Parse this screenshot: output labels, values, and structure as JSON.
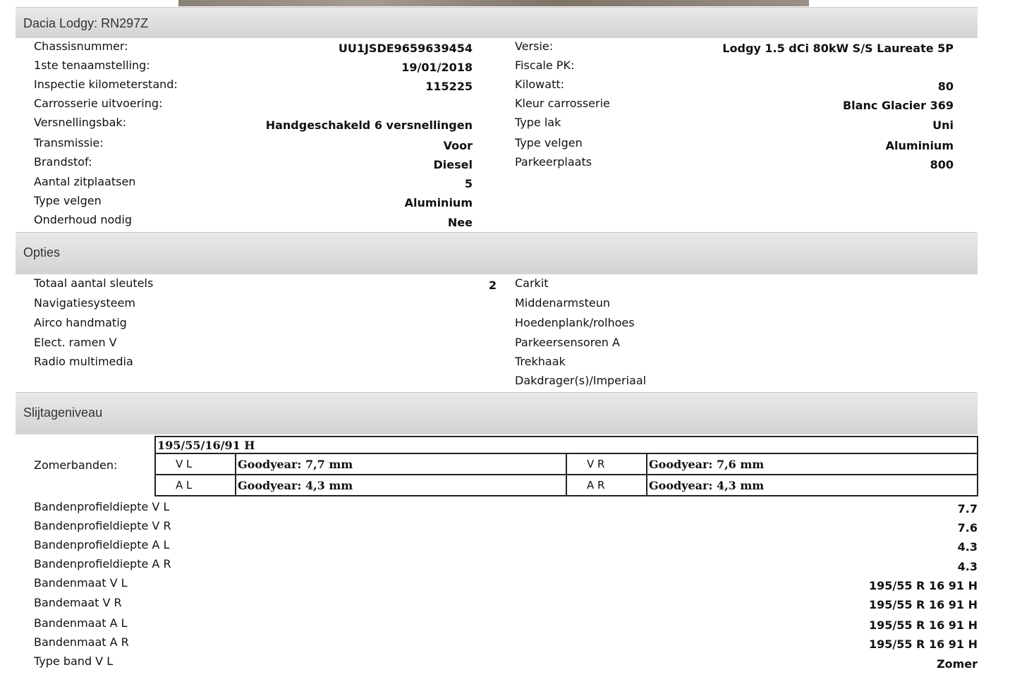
{
  "vehicle": {
    "title": "Dacia Lodgy: RN297Z",
    "left_specs": [
      {
        "label": "Chassisnummer:",
        "value": "UU1JSDE9659639454"
      },
      {
        "label": "1ste tenaamstelling:",
        "value": "19/01/2018"
      },
      {
        "label": "Inspectie kilometerstand:",
        "value": "115225"
      },
      {
        "label": "Carrosserie uitvoering:",
        "value": ""
      },
      {
        "label": "Versnellingsbak:",
        "value": "Handgeschakeld 6 versnellingen"
      },
      {
        "label": "Transmissie:",
        "value": "Voor"
      },
      {
        "label": "Brandstof:",
        "value": "Diesel"
      },
      {
        "label": "Aantal zitplaatsen",
        "value": "5"
      },
      {
        "label": "Type velgen",
        "value": "Aluminium"
      },
      {
        "label": "Onderhoud nodig",
        "value": "Nee"
      }
    ],
    "right_specs": [
      {
        "label": "Versie:",
        "value": "Lodgy 1.5 dCi 80kW S/S Laureate 5P"
      },
      {
        "label": "Fiscale PK:",
        "value": ""
      },
      {
        "label": "Kilowatt:",
        "value": "80"
      },
      {
        "label": "Kleur carrosserie",
        "value": "Blanc Glacier 369"
      },
      {
        "label": "Type lak",
        "value": "Uni"
      },
      {
        "label": "Type velgen",
        "value": "Aluminium"
      },
      {
        "label": "Parkeerplaats",
        "value": "800"
      }
    ]
  },
  "options": {
    "title": "Opties",
    "left_items": [
      {
        "label": "Totaal aantal sleutels",
        "value": "2"
      },
      {
        "label": "Navigatiesysteem",
        "value": ""
      },
      {
        "label": "Airco handmatig",
        "value": ""
      },
      {
        "label": "Elect. ramen V",
        "value": ""
      },
      {
        "label": "Radio multimedia",
        "value": ""
      }
    ],
    "right_items": [
      "Carkit",
      "Middenarmsteun",
      "Hoedenplank/rolhoes",
      "Parkeersensoren A",
      "Trekhaak",
      "Dakdrager(s)/Imperiaal"
    ]
  },
  "wear": {
    "title": "Slijtageniveau",
    "summer_label": "Zomerbanden:",
    "tyre_size": "195/55/16/91 H",
    "tyres": [
      {
        "pos": "V L",
        "value": "Goodyear: 7,7 mm",
        "pos2": "V R",
        "value2": "Goodyear: 7,6 mm"
      },
      {
        "pos": "A L",
        "value": "Goodyear: 4,3 mm",
        "pos2": "A R",
        "value2": "Goodyear: 4,3 mm"
      }
    ],
    "rows": [
      {
        "label": "Bandenprofieldiepte V L",
        "value": "7.7"
      },
      {
        "label": "Bandenprofieldiepte V R",
        "value": "7.6"
      },
      {
        "label": "Bandenprofieldiepte A L",
        "value": "4.3"
      },
      {
        "label": "Bandenprofieldiepte A R",
        "value": "4.3"
      },
      {
        "label": "Bandenmaat V L",
        "value": "195/55 R 16 91 H"
      },
      {
        "label": "Bandemaat V R",
        "value": "195/55 R 16 91 H"
      },
      {
        "label": "Bandenmaat A L",
        "value": "195/55 R 16 91 H"
      },
      {
        "label": "Bandenmaat A R",
        "value": "195/55 R 16 91 H"
      },
      {
        "label": "Type band V L",
        "value": "Zomer"
      }
    ]
  }
}
